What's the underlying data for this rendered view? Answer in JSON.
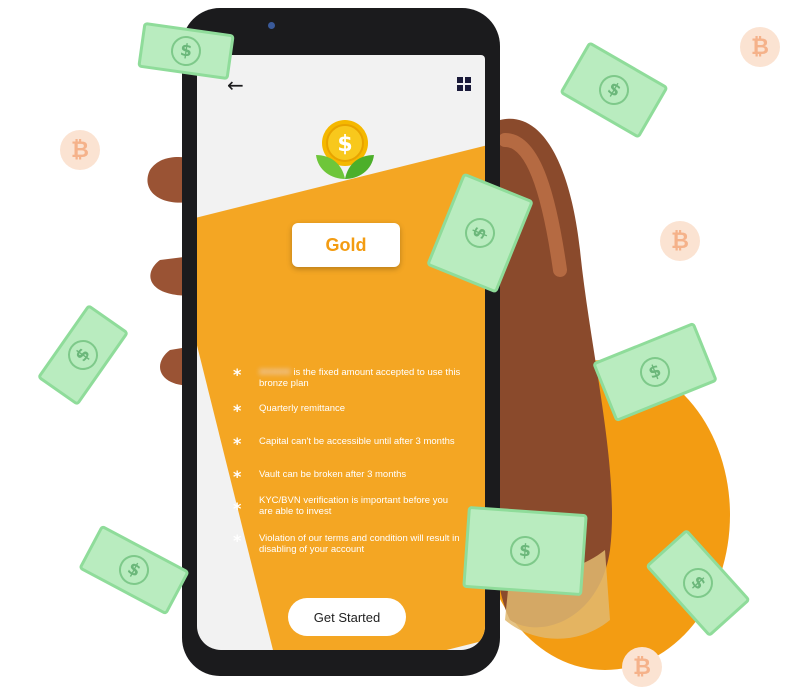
{
  "colors": {
    "accent": "#f4a623",
    "badge_text": "#f39c12",
    "bill_green": "#b9ecbf",
    "coin": "#fbe3d2"
  },
  "icons": [
    "back-arrow-icon",
    "grid-menu-icon",
    "dollar-plant-icon",
    "bitcoin-icon",
    "dollar-bill-icon"
  ],
  "header": {
    "back_icon": "←"
  },
  "plan": {
    "name": "Gold"
  },
  "features": [
    {
      "blurred": "000000",
      "text": " is the fixed amount accepted to use this bronze plan"
    },
    {
      "text": "Quarterly remittance"
    },
    {
      "text": "Capital can't be accessible until after 3 months"
    },
    {
      "text": "Vault can be broken after 3 months"
    },
    {
      "text": "KYC/BVN verification is important before you are able to invest"
    },
    {
      "text": "Violation of our terms and condition will result in disabling of your account"
    }
  ],
  "feature_bullet": "*",
  "cta": {
    "label": "Get Started"
  },
  "decor": {
    "bitcoin_symbol": "₿",
    "dollar_symbol": "$"
  }
}
